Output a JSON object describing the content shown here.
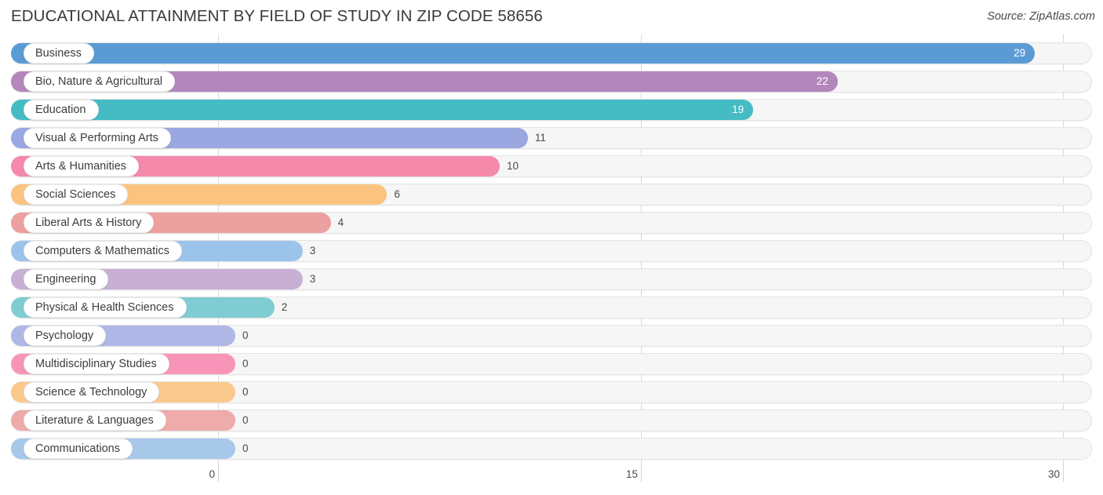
{
  "header": {
    "title": "EDUCATIONAL ATTAINMENT BY FIELD OF STUDY IN ZIP CODE 58656",
    "source": "Source: ZipAtlas.com"
  },
  "chart_data": {
    "type": "bar",
    "orientation": "horizontal",
    "title": "EDUCATIONAL ATTAINMENT BY FIELD OF STUDY IN ZIP CODE 58656",
    "xlabel": "",
    "ylabel": "",
    "xlim": [
      0,
      30
    ],
    "xticks": [
      0,
      15,
      30
    ],
    "xtick_labels": [
      "0",
      "15",
      "30"
    ],
    "grid": true,
    "legend": false,
    "categories": [
      "Business",
      "Bio, Nature & Agricultural",
      "Education",
      "Visual & Performing Arts",
      "Arts & Humanities",
      "Social Sciences",
      "Liberal Arts & History",
      "Computers & Mathematics",
      "Engineering",
      "Physical & Health Sciences",
      "Psychology",
      "Multidisciplinary Studies",
      "Science & Technology",
      "Literature & Languages",
      "Communications"
    ],
    "values": [
      29,
      22,
      19,
      11,
      10,
      6,
      4,
      3,
      3,
      2,
      0,
      0,
      0,
      0,
      0
    ],
    "value_labels": [
      "29",
      "22",
      "19",
      "11",
      "10",
      "6",
      "4",
      "3",
      "3",
      "2",
      "0",
      "0",
      "0",
      "0",
      "0"
    ],
    "colors": [
      "#5b9bd5",
      "#b387bc",
      "#45bcc3",
      "#9aa7e0",
      "#f589ab",
      "#fbc47e",
      "#eda0a0",
      "#9cc3ea",
      "#c7b0d4",
      "#7fcdd2",
      "#aeb7e6",
      "#f894b7",
      "#fbc98d",
      "#efaaaa",
      "#a8c8ea"
    ]
  }
}
